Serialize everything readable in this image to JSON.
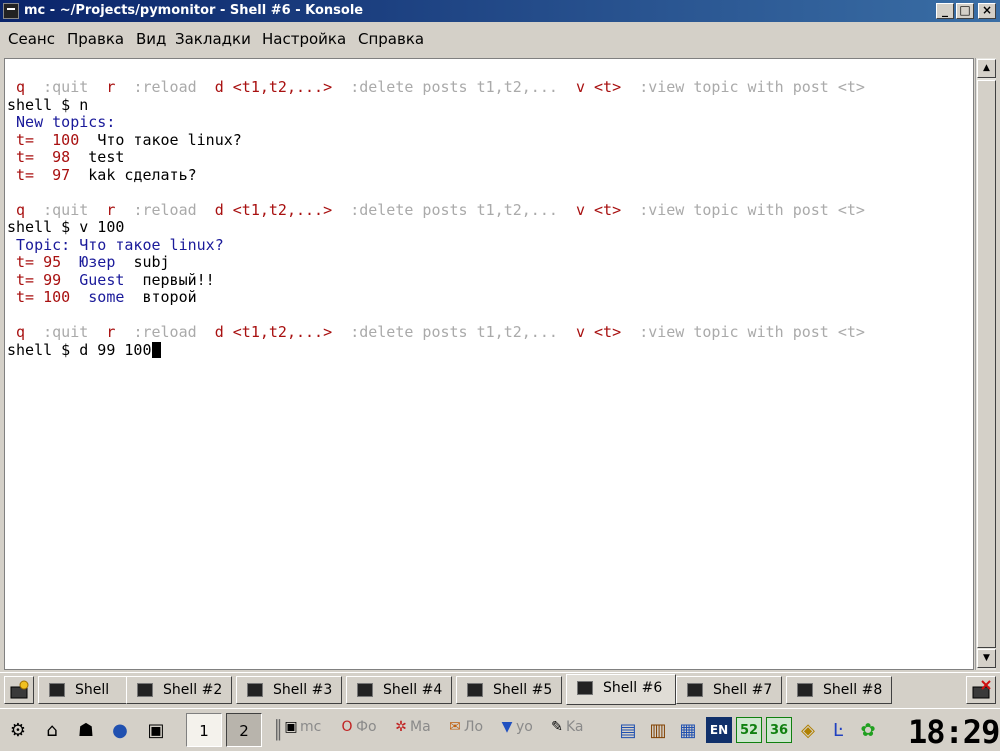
{
  "window": {
    "title": "mc - ~/Projects/pymonitor - Shell #6 - Konsole",
    "minimize": "_",
    "maximize": "□",
    "close": "×"
  },
  "menu": [
    "Сеанс",
    "Правка",
    "Вид",
    "Закладки",
    "Настройка",
    "Справка"
  ],
  "terminal": {
    "help": {
      "q": "q",
      "quit": ":quit",
      "r": "r",
      "reload": ":reload",
      "d": "d <t1,t2,...>",
      "delete": ":delete posts t1,t2,...",
      "v": "v <t>",
      "view": ":view topic with post <t>"
    },
    "prompt": "shell $ ",
    "cmd1": "n",
    "new_topics": "New topics:",
    "topics": [
      {
        "t": "t=  100",
        "title": "Что такое linux?"
      },
      {
        "t": "t=  98",
        "title": "test"
      },
      {
        "t": "t=  97",
        "title": "kak сделать?"
      }
    ],
    "cmd2": "v 100",
    "topic_header": "Topic: Что такое linux?",
    "posts": [
      {
        "t": "t= 95",
        "author": "Юзер",
        "subj": "subj"
      },
      {
        "t": "t= 99",
        "author": "Guest",
        "subj": "первый!!"
      },
      {
        "t": "t= 100",
        "author": "some",
        "subj": "второй"
      }
    ],
    "cmd3": "d 99 100"
  },
  "tabs": [
    "Shell",
    "Shell #2",
    "Shell #3",
    "Shell #4",
    "Shell #5",
    "Shell #6",
    "Shell #7",
    "Shell #8"
  ],
  "active_tab": "Shell #6",
  "panel": {
    "desktops": [
      "1",
      "2"
    ],
    "tasks": [
      "mc",
      "Фо",
      "Ма",
      "Ло",
      "yo",
      "Ka"
    ],
    "lang": "EN",
    "tray_num1": "52",
    "tray_num2": "36",
    "clock": "18:29"
  }
}
